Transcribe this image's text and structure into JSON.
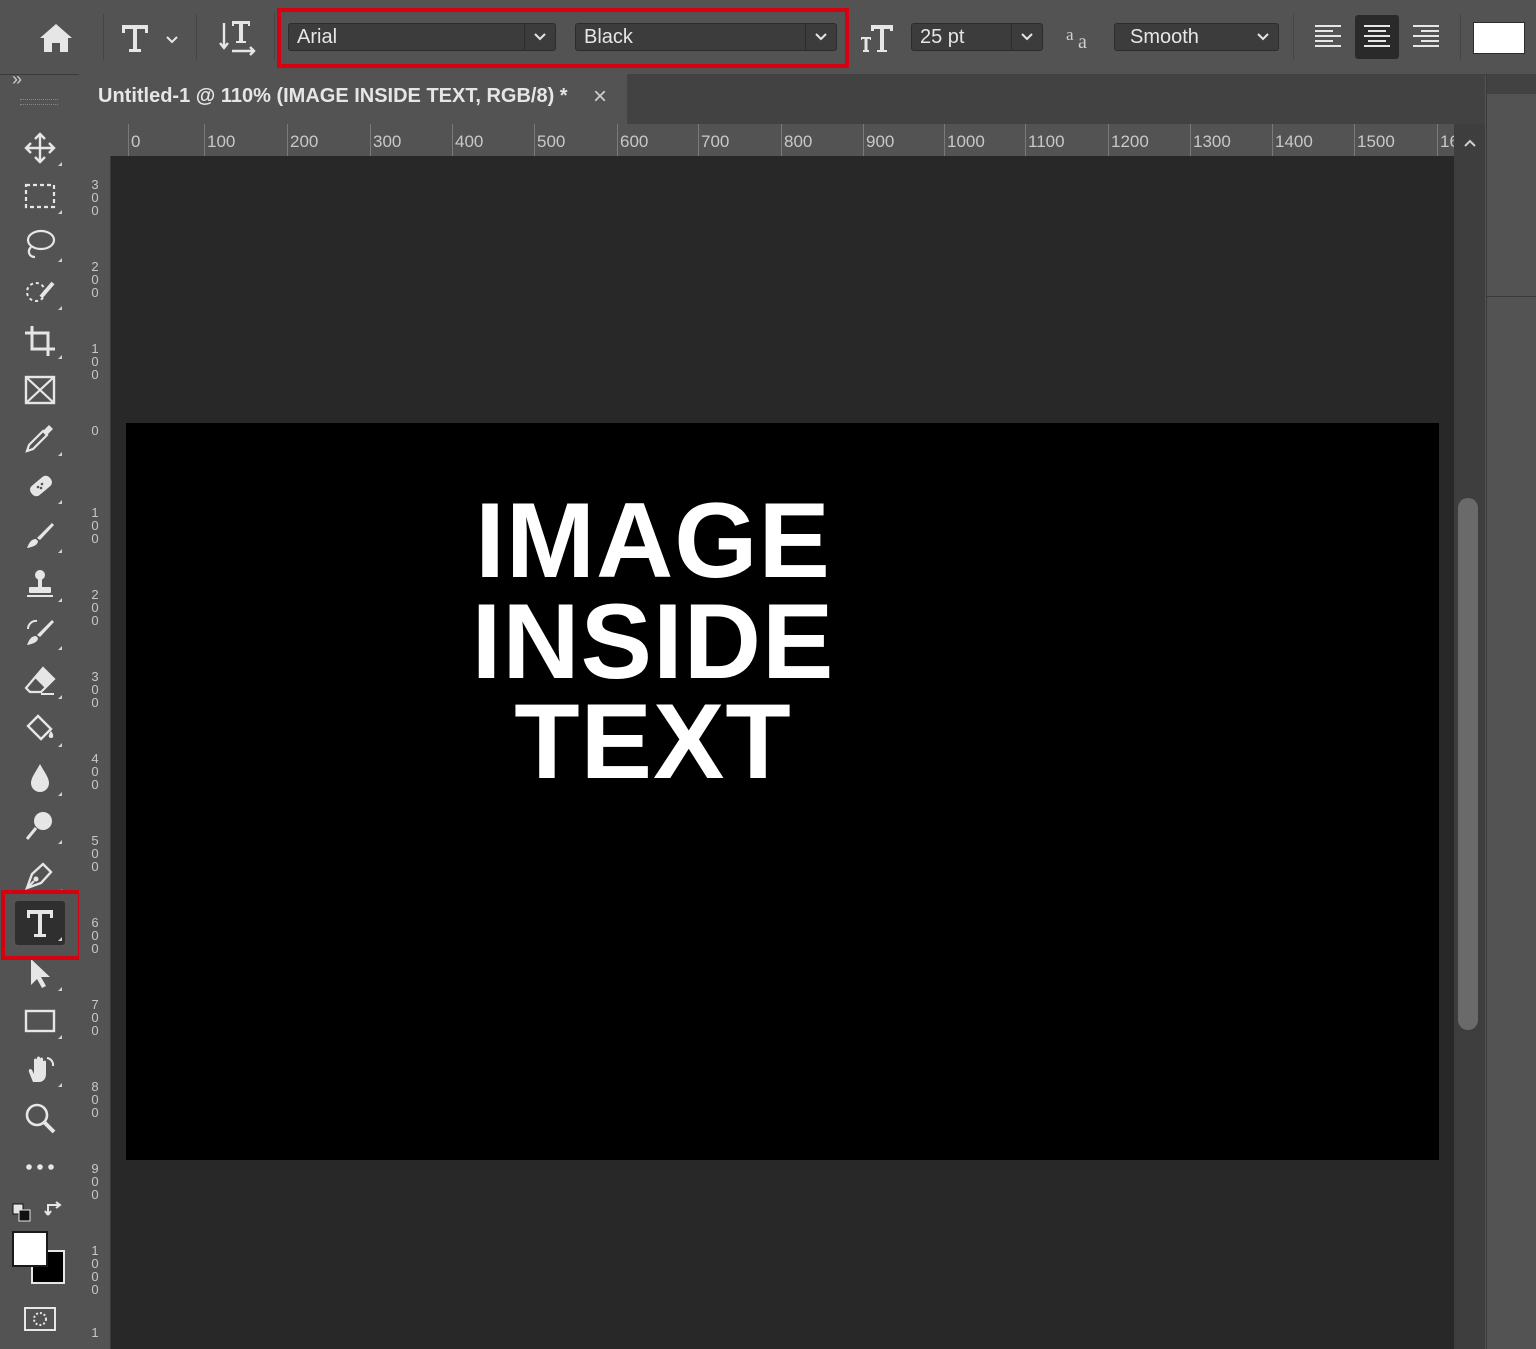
{
  "options_bar": {
    "font_family": "Arial",
    "font_style": "Black",
    "font_size": "25 pt",
    "antialias": "Smooth",
    "color_swatch": "#ffffff"
  },
  "panel_collapse_label": "»",
  "document": {
    "tab_title": "Untitled-1 @ 110% (IMAGE INSIDE TEXT, RGB/8) *",
    "close_glyph": "×",
    "text_lines": [
      "IMAGE",
      "INSIDE",
      "TEXT"
    ]
  },
  "rulers": {
    "top": [
      "0",
      "100",
      "200",
      "300",
      "400",
      "500",
      "600",
      "700",
      "800",
      "900",
      "1000",
      "1100",
      "1200",
      "1300",
      "1400",
      "1500",
      "16"
    ],
    "left": [
      "300",
      "200",
      "100",
      "0",
      "100",
      "200",
      "300",
      "400",
      "500",
      "600",
      "700",
      "800",
      "900",
      "1000",
      "1"
    ]
  },
  "tools": [
    {
      "name": "move-tool",
      "icon": "move-icon"
    },
    {
      "name": "rectangular-marquee-tool",
      "icon": "marquee-icon"
    },
    {
      "name": "lasso-tool",
      "icon": "lasso-icon"
    },
    {
      "name": "quick-selection-tool",
      "icon": "quick-selection-icon"
    },
    {
      "name": "crop-tool",
      "icon": "crop-icon"
    },
    {
      "name": "frame-tool",
      "icon": "frame-icon"
    },
    {
      "name": "eyedropper-tool",
      "icon": "eyedropper-icon"
    },
    {
      "name": "spot-healing-tool",
      "icon": "bandage-icon"
    },
    {
      "name": "brush-tool",
      "icon": "brush-icon"
    },
    {
      "name": "clone-stamp-tool",
      "icon": "stamp-icon"
    },
    {
      "name": "history-brush-tool",
      "icon": "history-brush-icon"
    },
    {
      "name": "eraser-tool",
      "icon": "eraser-icon"
    },
    {
      "name": "paint-bucket-tool",
      "icon": "bucket-icon"
    },
    {
      "name": "blur-tool",
      "icon": "drop-icon"
    },
    {
      "name": "dodge-tool",
      "icon": "dodge-icon"
    },
    {
      "name": "pen-tool",
      "icon": "pen-icon"
    },
    {
      "name": "type-tool",
      "icon": "type-icon",
      "selected": true
    },
    {
      "name": "path-selection-tool",
      "icon": "arrow-icon"
    },
    {
      "name": "rectangle-tool",
      "icon": "rectangle-icon"
    },
    {
      "name": "hand-tool",
      "icon": "hand-icon"
    },
    {
      "name": "zoom-tool",
      "icon": "zoom-icon"
    },
    {
      "name": "edit-toolbar",
      "icon": "more-icon"
    }
  ],
  "colors": {
    "foreground": "#ffffff",
    "background": "#000000",
    "highlight": "#d7000f"
  }
}
